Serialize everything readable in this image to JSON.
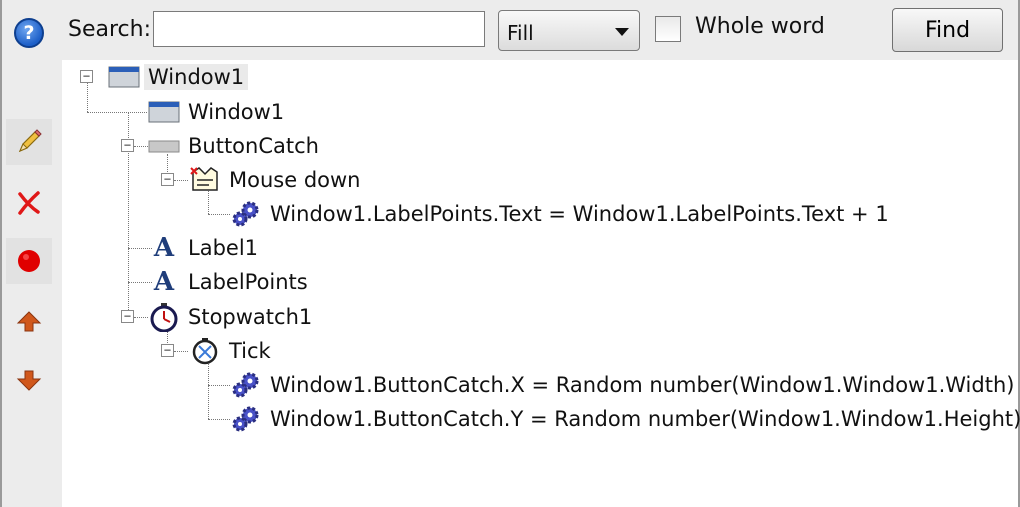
{
  "toolbar": {
    "help_icon": "help-icon",
    "search_label": "Search:",
    "search_value": "",
    "fill_selected": "Fill",
    "whole_word_label": "Whole word",
    "whole_word_checked": false,
    "find_label": "Find"
  },
  "side_tools": [
    "edit-icon",
    "delete-icon",
    "record-icon",
    "move-up-icon",
    "move-down-icon"
  ],
  "tree": {
    "root": "Window1",
    "window_child": "Window1",
    "button_catch": "ButtonCatch",
    "mouse_down": "Mouse down",
    "mouse_down_action": "Window1.LabelPoints.Text = Window1.LabelPoints.Text + 1",
    "label1": "Label1",
    "label_points": "LabelPoints",
    "stopwatch": "Stopwatch1",
    "tick": "Tick",
    "tick_action_x": "Window1.ButtonCatch.X = Random number(Window1.Window1.Width)",
    "tick_action_y": "Window1.ButtonCatch.Y = Random number(Window1.Window1.Height)"
  },
  "colors": {
    "accent_blue": "#1d5fc8",
    "delete_red": "#e01818",
    "record_red": "#e00000",
    "arrow_orange": "#d0581c",
    "gear_blue": "#4a52c8"
  }
}
